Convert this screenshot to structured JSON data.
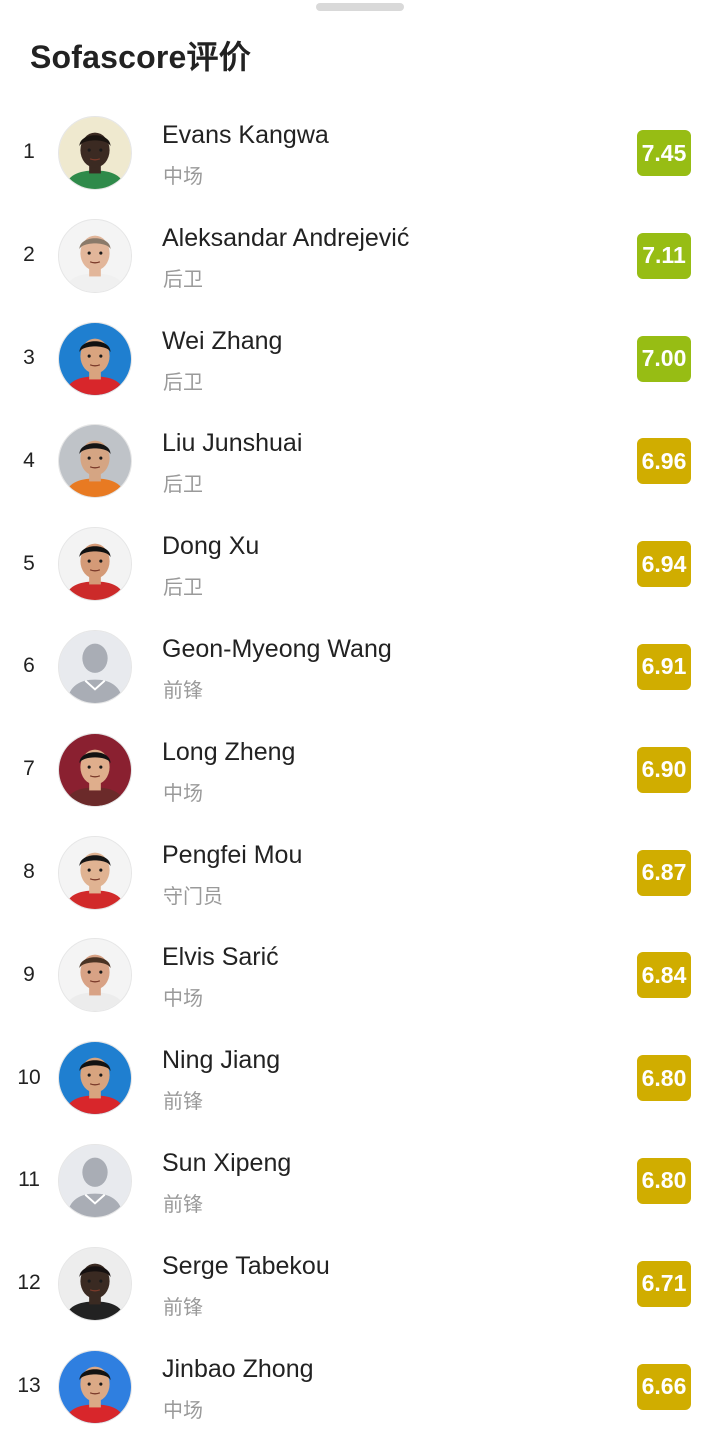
{
  "title": "Sofascore评价",
  "colors": {
    "rating_high": "#97bd14",
    "rating_mid": "#d0ad00"
  },
  "players": [
    {
      "rank": "1",
      "name": "Evans Kangwa",
      "position": "中场",
      "rating": "7.45",
      "tier": "high",
      "avatar": "player-photo",
      "skin": "#3b2a22",
      "hair": "#1a1410",
      "shirt": "#2f8a4a",
      "bg": "#efe9cf"
    },
    {
      "rank": "2",
      "name": "Aleksandar Andrejević",
      "position": "后卫",
      "rating": "7.11",
      "tier": "high",
      "avatar": "player-photo",
      "skin": "#e2b69a",
      "hair": "#8a7a6a",
      "shirt": "#f0f0f0",
      "bg": "#f4f4f4"
    },
    {
      "rank": "3",
      "name": "Wei Zhang",
      "position": "后卫",
      "rating": "7.00",
      "tier": "high",
      "avatar": "player-photo",
      "skin": "#d9a47f",
      "hair": "#111111",
      "shirt": "#d8262b",
      "bg": "#1f7fd0"
    },
    {
      "rank": "4",
      "name": "Liu Junshuai",
      "position": "后卫",
      "rating": "6.96",
      "tier": "mid",
      "avatar": "player-photo",
      "skin": "#d5a583",
      "hair": "#151515",
      "shirt": "#e87a22",
      "bg": "#bfc3c8"
    },
    {
      "rank": "5",
      "name": "Dong Xu",
      "position": "后卫",
      "rating": "6.94",
      "tier": "mid",
      "avatar": "player-photo",
      "skin": "#d49a77",
      "hair": "#111111",
      "shirt": "#cc2a2a",
      "bg": "#f3f3f3"
    },
    {
      "rank": "6",
      "name": "Geon-Myeong Wang",
      "position": "前锋",
      "rating": "6.91",
      "tier": "mid",
      "avatar": "placeholder",
      "skin": "#a9adb5",
      "hair": "#a9adb5",
      "shirt": "#a9adb5",
      "bg": "#e8eaee"
    },
    {
      "rank": "7",
      "name": "Long Zheng",
      "position": "中场",
      "rating": "6.90",
      "tier": "mid",
      "avatar": "player-photo",
      "skin": "#dfae8c",
      "hair": "#121212",
      "shirt": "#6b2a2a",
      "bg": "#8a2030"
    },
    {
      "rank": "8",
      "name": "Pengfei Mou",
      "position": "守门员",
      "rating": "6.87",
      "tier": "mid",
      "avatar": "player-photo",
      "skin": "#e0b392",
      "hair": "#161616",
      "shirt": "#d12a2a",
      "bg": "#f4f4f4"
    },
    {
      "rank": "9",
      "name": "Elvis Sarić",
      "position": "中场",
      "rating": "6.84",
      "tier": "mid",
      "avatar": "player-photo",
      "skin": "#d8a285",
      "hair": "#4a3324",
      "shirt": "#ececec",
      "bg": "#f4f4f4"
    },
    {
      "rank": "10",
      "name": "Ning Jiang",
      "position": "前锋",
      "rating": "6.80",
      "tier": "mid",
      "avatar": "player-photo",
      "skin": "#d8a47f",
      "hair": "#121212",
      "shirt": "#d8262b",
      "bg": "#1f7fd0"
    },
    {
      "rank": "11",
      "name": "Sun Xipeng",
      "position": "前锋",
      "rating": "6.80",
      "tier": "mid",
      "avatar": "placeholder",
      "skin": "#a9adb5",
      "hair": "#a9adb5",
      "shirt": "#a9adb5",
      "bg": "#e8eaee"
    },
    {
      "rank": "12",
      "name": "Serge Tabekou",
      "position": "前锋",
      "rating": "6.71",
      "tier": "mid",
      "avatar": "player-photo",
      "skin": "#3a2a22",
      "hair": "#151010",
      "shirt": "#222222",
      "bg": "#ededed"
    },
    {
      "rank": "13",
      "name": "Jinbao Zhong",
      "position": "中场",
      "rating": "6.66",
      "tier": "mid",
      "avatar": "player-photo",
      "skin": "#dba986",
      "hair": "#121212",
      "shirt": "#d8262b",
      "bg": "#2f7fe0"
    }
  ]
}
